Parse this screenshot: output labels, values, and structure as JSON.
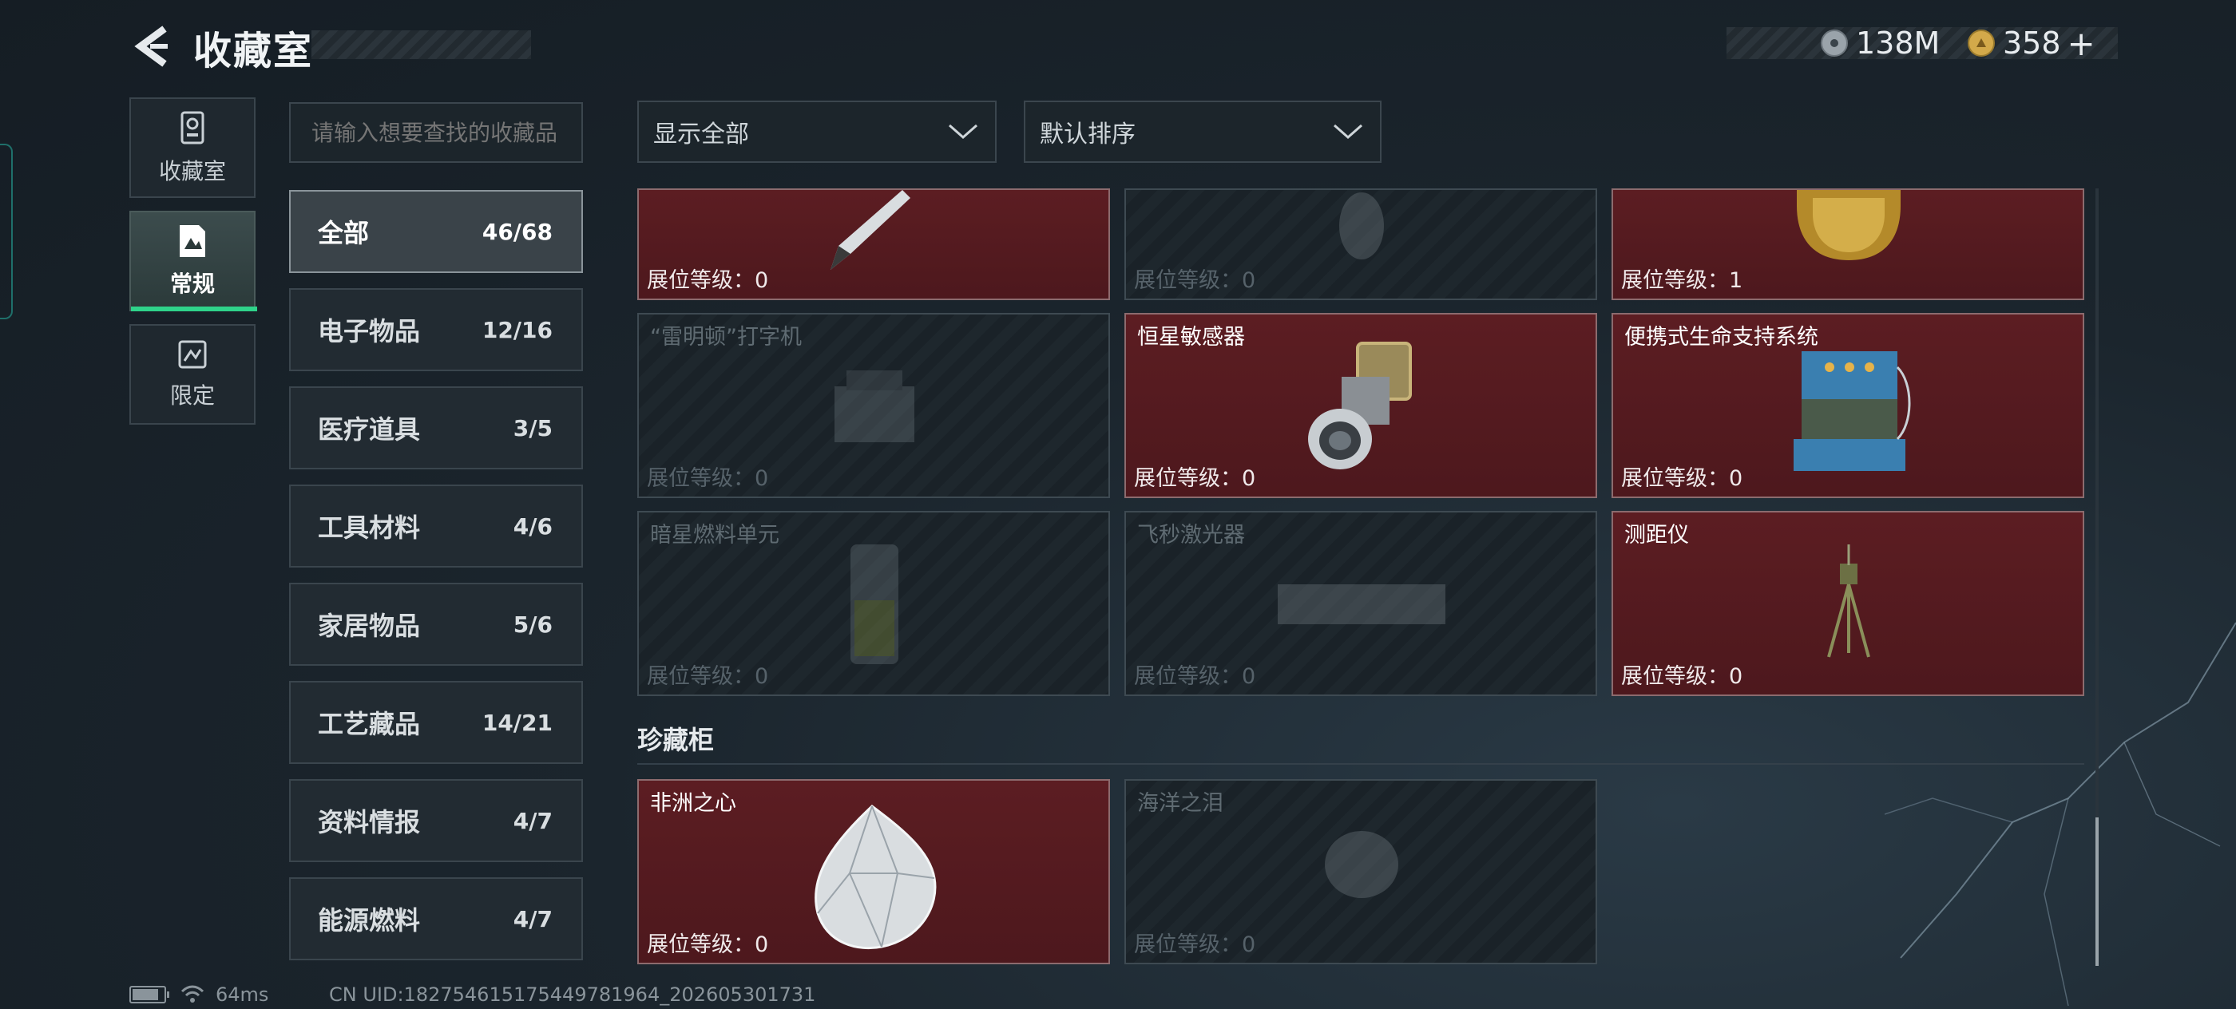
{
  "header": {
    "title": "收藏室",
    "currency": [
      {
        "icon": "silver-coin-icon",
        "value": "138M"
      },
      {
        "icon": "gold-coin-icon",
        "value": "358",
        "plus": "+"
      }
    ]
  },
  "left_nav": [
    {
      "label": "收藏室",
      "icon": "trophy-cabinet-icon",
      "active": false
    },
    {
      "label": "常规",
      "icon": "document-image-icon",
      "active": true
    },
    {
      "label": "限定",
      "icon": "limited-card-icon",
      "active": false
    }
  ],
  "search": {
    "placeholder": "请输入想要查找的收藏品"
  },
  "filters": {
    "display": {
      "label": "显示全部"
    },
    "sort": {
      "label": "默认排序"
    }
  },
  "categories": [
    {
      "name": "全部",
      "count": "46/68",
      "active": true
    },
    {
      "name": "电子物品",
      "count": "12/16"
    },
    {
      "name": "医疗道具",
      "count": "3/5"
    },
    {
      "name": "工具材料",
      "count": "4/6"
    },
    {
      "name": "家居物品",
      "count": "5/6"
    },
    {
      "name": "工艺藏品",
      "count": "14/21"
    },
    {
      "name": "资料情报",
      "count": "4/7"
    },
    {
      "name": "能源燃料",
      "count": "4/7"
    }
  ],
  "items": [
    {
      "name": "",
      "level": "展位等级：0",
      "owned": true,
      "art": "pen-icon"
    },
    {
      "name": "",
      "level": "展位等级：0",
      "owned": false,
      "art": "unknown-item-icon"
    },
    {
      "name": "",
      "level": "展位等级：1",
      "owned": true,
      "art": "golden-statue-icon"
    },
    {
      "name": "“雷明顿”打字机",
      "level": "展位等级：0",
      "owned": false,
      "art": "typewriter-icon"
    },
    {
      "name": "恒星敏感器",
      "level": "展位等级：0",
      "owned": true,
      "art": "star-sensor-icon"
    },
    {
      "name": "便携式生命支持系统",
      "level": "展位等级：0",
      "owned": true,
      "art": "life-support-icon"
    },
    {
      "name": "暗星燃料单元",
      "level": "展位等级：0",
      "owned": false,
      "art": "fuel-cell-icon"
    },
    {
      "name": "飞秒激光器",
      "level": "展位等级：0",
      "owned": false,
      "art": "laser-icon"
    },
    {
      "name": "测距仪",
      "level": "展位等级：0",
      "owned": true,
      "art": "rangefinder-tripod-icon"
    }
  ],
  "section": {
    "title": "珍藏柜"
  },
  "treasure_items": [
    {
      "name": "非洲之心",
      "level": "展位等级：0",
      "owned": true,
      "art": "diamond-icon"
    },
    {
      "name": "海洋之泪",
      "level": "展位等级：0",
      "owned": false,
      "art": "gem-icon"
    }
  ],
  "footer": {
    "battery_level": 0.85,
    "ping": "64ms",
    "uid": "CN UID:18275461517544978196​4_202605301731"
  },
  "colors": {
    "accent_green": "#2fd38a",
    "owned_card": "#561b20",
    "locked_card": "#1e272d"
  }
}
